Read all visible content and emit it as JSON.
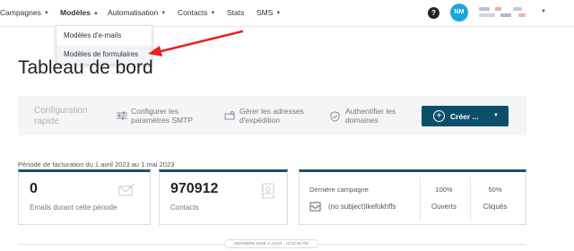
{
  "nav": {
    "items": [
      {
        "label": "Campagnes"
      },
      {
        "label": "Modèles"
      },
      {
        "label": "Automatisation"
      },
      {
        "label": "Contacts"
      },
      {
        "label": "Stats"
      },
      {
        "label": "SMS"
      }
    ],
    "help_icon": "?",
    "avatar_initials": "NM"
  },
  "dropdown": {
    "items": [
      {
        "label": "Modèles d'e-mails"
      },
      {
        "label": "Modèles de formulaires"
      }
    ]
  },
  "page": {
    "title": "Tableau de bord"
  },
  "quick_config": {
    "label": "Configuration rapide",
    "actions": [
      {
        "label": "Configurer les paramètres SMTP",
        "icon": "sliders-icon"
      },
      {
        "label": "Gérer les adresses d'expédition",
        "icon": "sender-icon"
      },
      {
        "label": "Authentifier les domaines",
        "icon": "shield-icon"
      }
    ],
    "create_label": "Créer ..."
  },
  "billing_period": "Période de facturation du 1 avril 2023 au 1 mai 2023",
  "stats": {
    "emails": {
      "value": "0",
      "label": "Emails durant cette période"
    },
    "contacts": {
      "value": "970912",
      "label": "Contacts"
    },
    "campaign": {
      "label": "Dernière campagne",
      "name": "(no subject)lkefokhffs",
      "open_rate": "100%",
      "open_label": "Ouverts",
      "click_rate": "50%",
      "click_label": "Cliqués"
    }
  },
  "last_update": "DERNIÈRE MISE À JOUR : 12:23:38 PM",
  "colors": {
    "accent": "#0b4f6c",
    "avatar": "#1aa7e0",
    "arrow": "#e52421"
  }
}
